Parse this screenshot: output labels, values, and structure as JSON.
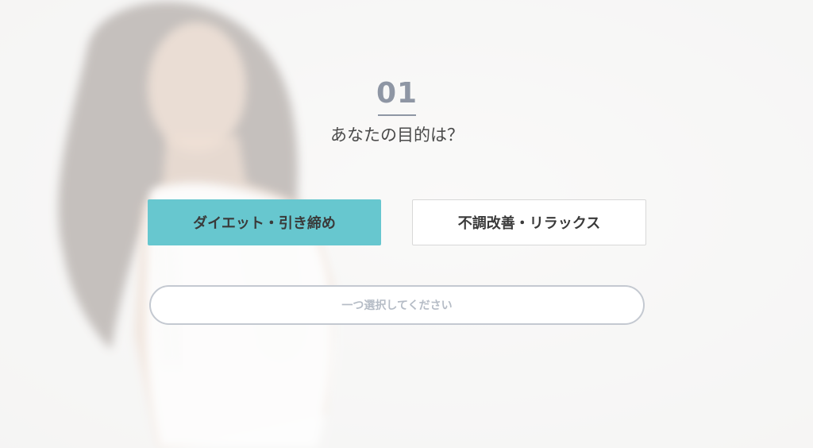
{
  "step": {
    "number": "01",
    "question": "あなたの目的は？"
  },
  "options": [
    {
      "label": "ダイエット・引き締め",
      "selected": true
    },
    {
      "label": "不調改善・リラックス",
      "selected": false
    }
  ],
  "submit": {
    "label": "一つ選択してください",
    "enabled": false
  },
  "colors": {
    "accent": "#67c7cf",
    "step_number": "#8e96a4",
    "submit_border": "#c4c9d1",
    "submit_text": "#b5bcc6"
  },
  "background": {
    "image": "smiling-woman-portrait-photo"
  }
}
